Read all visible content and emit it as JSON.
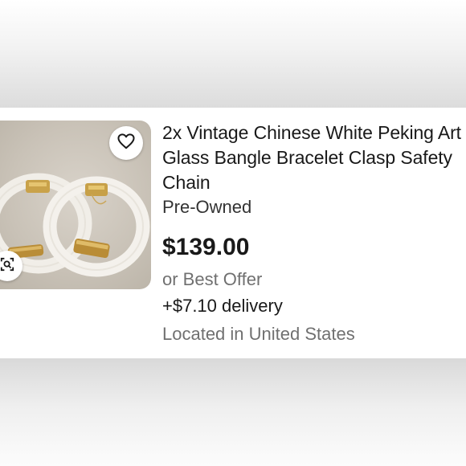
{
  "listing": {
    "title": "2x Vintage Chinese White Peking Art Glass Bangle Bracelet Clasp Safety Chain",
    "condition": "Pre-Owned",
    "price": "$139.00",
    "offer": "or Best Offer",
    "delivery": "+$7.10 delivery",
    "location": "Located in United States"
  },
  "icons": {
    "favorite": "heart-icon",
    "visual_search": "image-search-icon"
  },
  "colors": {
    "text_primary": "#191919",
    "text_secondary": "#707070",
    "card_background": "#ffffff"
  }
}
